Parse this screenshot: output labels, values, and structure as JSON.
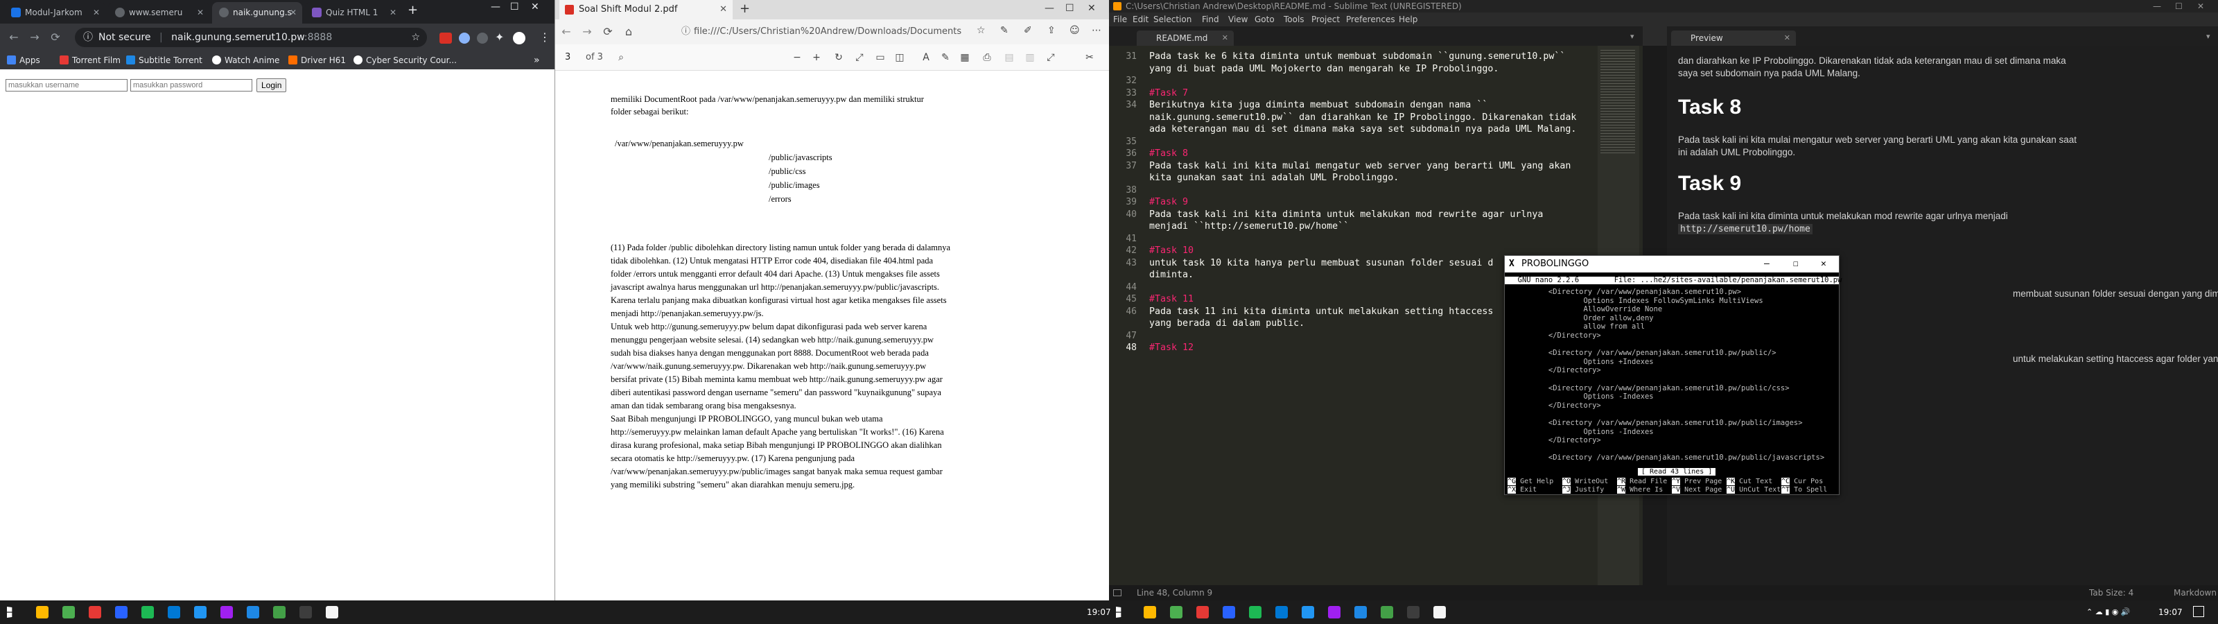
{
  "chrome": {
    "tabs": [
      {
        "label": "Modul-Jarkom",
        "color": "#1a73e8"
      },
      {
        "label": "www.semeru",
        "color": "#9aa0a6"
      },
      {
        "label": "naik.gunung.s",
        "color": "#9aa0a6"
      },
      {
        "label": "Quiz HTML 1",
        "color": "#7e57c2"
      }
    ],
    "new_tab": "+",
    "not_secure": "Not secure",
    "url_host": "naik.gunung.semerut10.pw",
    "url_port": ":8888",
    "bookmarks": [
      "Apps",
      "Torrent Film",
      "Subtitle Torrent",
      "Watch Anime",
      "Driver H61",
      "Cyber Security Cour..."
    ],
    "login": {
      "username_placeholder": "masukkan username",
      "password_placeholder": "masukkan password",
      "button": "Login"
    }
  },
  "edge": {
    "tab_title": "Soal Shift Modul 2.pdf",
    "address": "file:///C:/Users/Christian%20Andrew/Downloads/Documents/Soal",
    "page_current": "3",
    "page_total": "of 3",
    "pdf_lines": [
      "memiliki DocumentRoot pada /var/www/penanjakan.semeruyyy.pw dan memiliki struktur",
      "folder sebagai berikut:",
      "/var/www/penanjakan.semeruyyy.pw",
      "/public/javascripts",
      "/public/css",
      "/public/images",
      "/errors",
      "(11) Pada folder /public dibolehkan directory listing namun untuk folder yang berada di dalamnya",
      "tidak dibolehkan. (12) Untuk mengatasi HTTP Error code 404, disediakan file 404.html pada",
      "folder /errors untuk mengganti error default 404 dari Apache. (13) Untuk mengakses file assets",
      "javascript awalnya harus menggunakan url http://penanjakan.semeruyyy.pw/public/javascripts.",
      "Karena terlalu panjang maka dibuatkan konfigurasi virtual host agar ketika mengakses file assets",
      "menjadi http://penanjakan.semeruyyy.pw/js.",
      "Untuk web http://gunung.semeruyyy.pw belum dapat dikonfigurasi pada web server karena",
      "menunggu pengerjaan website selesai. (14) sedangkan web http://naik.gunung.semeruyyy.pw",
      "sudah bisa diakses hanya dengan menggunakan port 8888. DocumentRoot web berada pada",
      "/var/www/naik.gunung.semeruyyy.pw. Dikarenakan web http://naik.gunung.semeruyyy.pw",
      "bersifat private (15) Bibah meminta kamu membuat web http://naik.gunung.semeruyyy.pw agar",
      "diberi autentikasi password dengan username \"semeru\" dan password \"kuynaikgunung\" supaya",
      "aman dan tidak sembarang orang bisa mengaksesnya.",
      "Saat Bibah mengunjungi IP PROBOLINGGO, yang muncul bukan web utama",
      "http://semeruyyy.pw melainkan laman default Apache yang bertuliskan \"It works!\". (16) Karena",
      "dirasa kurang profesional, maka setiap Bibah mengunjungi IP PROBOLINGGO akan dialihkan",
      "secara otomatis ke http://semeruyyy.pw. (17) Karena pengunjung pada",
      "/var/www/penanjakan.semeruyyy.pw/public/images sangat banyak maka semua request gambar",
      "yang memiliki substring \"semeru\" akan diarahkan menuju semeru.jpg."
    ]
  },
  "sublime": {
    "title": "C:\\Users\\Christian Andrew\\Desktop\\README.md - Sublime Text (UNREGISTERED)",
    "menu": [
      "File",
      "Edit",
      "Selection",
      "Find",
      "View",
      "Goto",
      "Tools",
      "Project",
      "Preferences",
      "Help"
    ],
    "editor_tab": "README.md",
    "preview_tab": "Preview",
    "lines": [
      {
        "n": "31",
        "text": "Pada task ke 6 kita diminta untuk membuat subdomain ``gunung.semerut10.pw``"
      },
      {
        "n": "",
        "text": "yang di buat pada UML Mojokerto dan mengarah ke IP Probolinggo."
      },
      {
        "n": "32",
        "text": ""
      },
      {
        "n": "33",
        "text": "#Task 7"
      },
      {
        "n": "34",
        "text": "Berikutnya kita juga diminta membuat subdomain dengan nama ``"
      },
      {
        "n": "",
        "text": "naik.gunung.semerut10.pw`` dan diarahkan ke IP Probolinggo. Dikarenakan tidak"
      },
      {
        "n": "",
        "text": "ada keterangan mau di set dimana maka saya set subdomain nya pada UML Malang."
      },
      {
        "n": "35",
        "text": ""
      },
      {
        "n": "36",
        "text": "#Task 8"
      },
      {
        "n": "37",
        "text": "Pada task kali ini kita mulai mengatur web server yang berarti UML yang akan"
      },
      {
        "n": "",
        "text": "kita gunakan saat ini adalah UML Probolinggo."
      },
      {
        "n": "38",
        "text": ""
      },
      {
        "n": "39",
        "text": "#Task 9"
      },
      {
        "n": "40",
        "text": "Pada task kali ini kita diminta untuk melakukan mod rewrite agar urlnya"
      },
      {
        "n": "",
        "text": "menjadi ``http://semerut10.pw/home``"
      },
      {
        "n": "41",
        "text": ""
      },
      {
        "n": "42",
        "text": "#Task 10"
      },
      {
        "n": "43",
        "text": "untuk task 10 kita hanya perlu membuat susunan folder sesuai d"
      },
      {
        "n": "",
        "text": "diminta."
      },
      {
        "n": "44",
        "text": ""
      },
      {
        "n": "45",
        "text": "#Task 11"
      },
      {
        "n": "46",
        "text": "Pada task 11 ini kita diminta untuk melakukan setting htaccess"
      },
      {
        "n": "",
        "text": "yang berada di dalam public."
      },
      {
        "n": "47",
        "text": ""
      },
      {
        "n": "48",
        "text": "#Task 12"
      }
    ],
    "preview": {
      "p_top": "dan diarahkan ke IP Probolinggo. Dikarenakan tidak ada keterangan mau di set dimana maka",
      "p_top2": "saya set subdomain nya pada UML Malang.",
      "h8": "Task 8",
      "p8a": "Pada task kali ini kita mulai mengatur web server yang berarti UML yang akan kita gunakan saat",
      "p8b": "ini adalah UML Probolinggo.",
      "h9": "Task 9",
      "p9": "Pada task kali ini kita diminta untuk melakukan mod rewrite agar urlnya menjadi",
      "code9": "http://semerut10.pw/home",
      "p10_tail": "membuat susunan folder sesuai dengan yang diminta.",
      "p11_tail": "untuk melakukan setting htaccess agar folder yang berada di dalam"
    },
    "status_left": "Line 48, Column 9",
    "status_tab": "Tab Size: 4",
    "status_syntax": "Markdown"
  },
  "nano": {
    "window_title": "PROBOLINGGO",
    "header": "  GNU nano 2.2.6        File: ...he2/sites-available/penanjakan.semerut10.pw",
    "lines": [
      "         <Directory /var/www/penanjakan.semerut10.pw>",
      "                 Options Indexes FollowSymLinks MultiViews",
      "                 AllowOverride None",
      "                 Order allow,deny",
      "                 allow from all",
      "         </Directory>",
      "",
      "         <Directory /var/www/penanjakan.semerut10.pw/public/>",
      "                 Options +Indexes",
      "         </Directory>",
      "",
      "         <Directory /var/www/penanjakan.semerut10.pw/public/css>",
      "                 Options -Indexes",
      "         </Directory>",
      "",
      "         <Directory /var/www/penanjakan.semerut10.pw/public/images>",
      "                 Options -Indexes",
      "         </Directory>",
      "",
      "         <Directory /var/www/penanjakan.semerut10.pw/public/javascripts>"
    ],
    "message": "[ Read 43 lines ]",
    "keys_row1": [
      {
        "k": "^G",
        "l": "Get Help"
      },
      {
        "k": "^O",
        "l": "WriteOut"
      },
      {
        "k": "^R",
        "l": "Read File"
      },
      {
        "k": "^Y",
        "l": "Prev Page"
      },
      {
        "k": "^K",
        "l": "Cut Text"
      },
      {
        "k": "^C",
        "l": "Cur Pos"
      }
    ],
    "keys_row2": [
      {
        "k": "^X",
        "l": "Exit"
      },
      {
        "k": "^J",
        "l": "Justify"
      },
      {
        "k": "^W",
        "l": "Where Is"
      },
      {
        "k": "^V",
        "l": "Next Page"
      },
      {
        "k": "^U",
        "l": "UnCut Text"
      },
      {
        "k": "^T",
        "l": "To Spell"
      }
    ]
  },
  "taskbar": {
    "time_left": "19:07",
    "time_right": "19:07",
    "app_colors": [
      "#ffb900",
      "#4caf50",
      "#e53935",
      "#2962ff",
      "#1db954",
      "#0078d4",
      "#2196f3",
      "#a020f0",
      "#1e88e5",
      "#43a047",
      "#3d3d3d",
      "#f5f5f5"
    ]
  }
}
